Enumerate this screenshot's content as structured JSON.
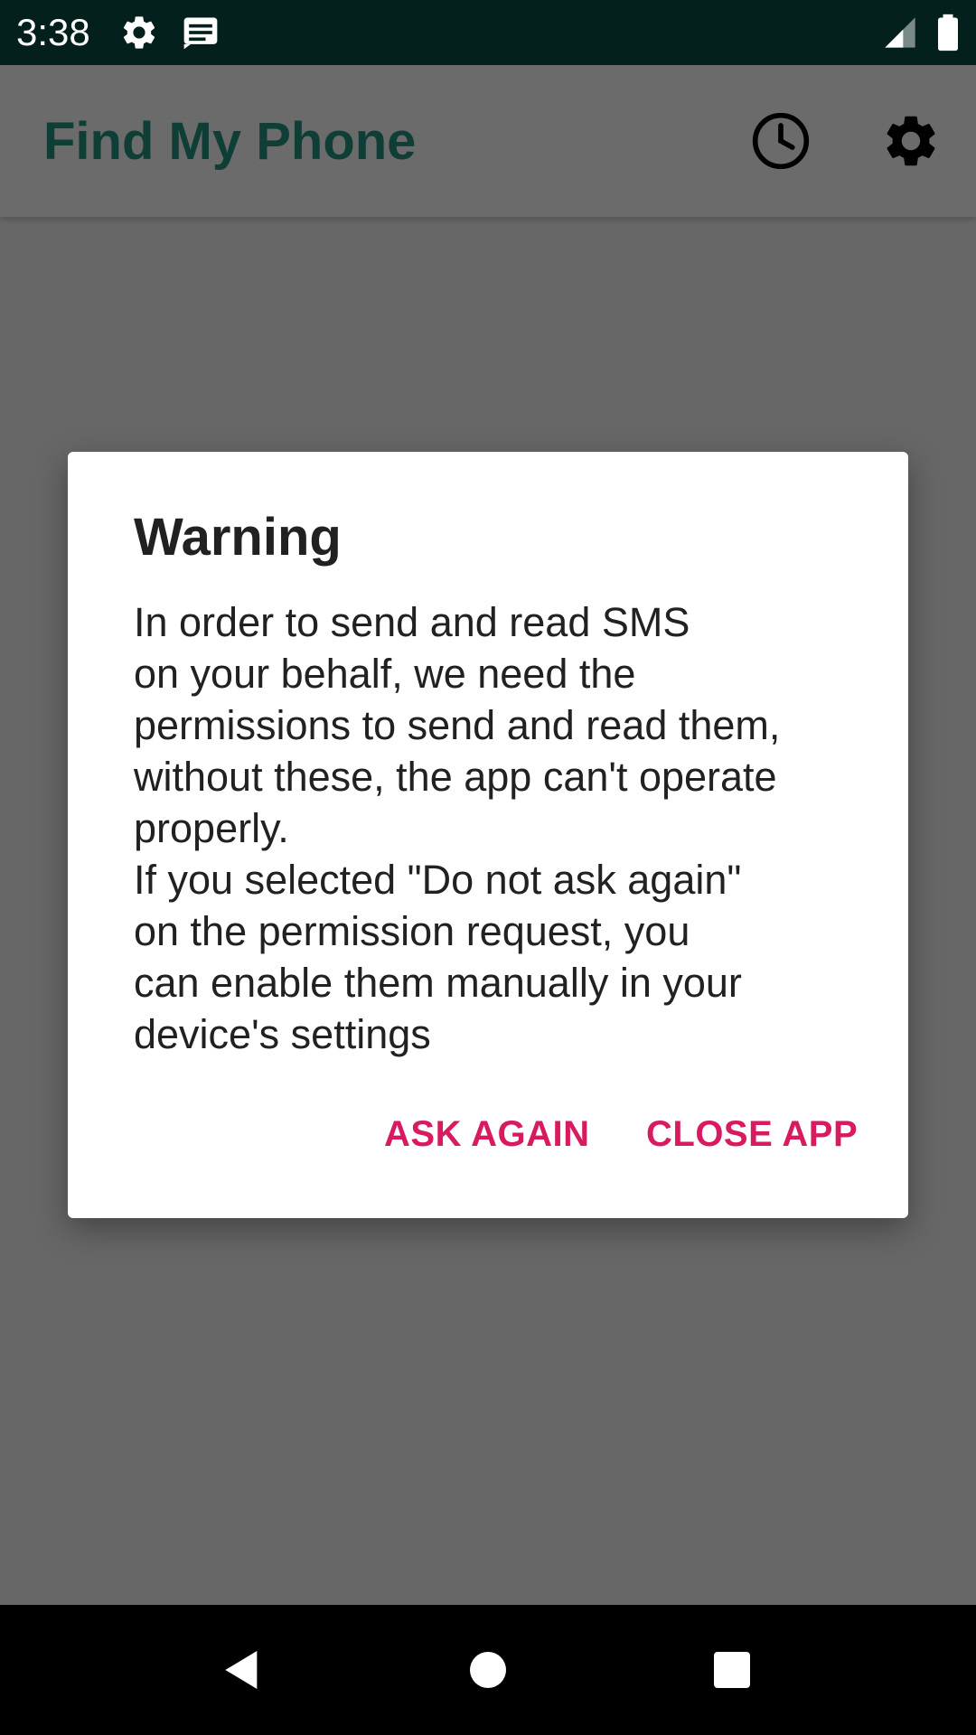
{
  "status_bar": {
    "time": "3:38",
    "icons": [
      "settings-icon",
      "message-icon",
      "signal-icon",
      "battery-icon"
    ]
  },
  "app_bar": {
    "title": "Find My Phone",
    "actions": [
      "history-icon",
      "settings-icon"
    ],
    "title_color": "#0f3e37"
  },
  "dialog": {
    "title": "Warning",
    "message": "In order to send and read SMS\non your behalf, we need the\npermissions to send and read them,\nwithout these, the app can't operate\nproperly.\nIf you selected \"Do not ask again\"\non the permission request, you\ncan enable them manually in your\ndevice's settings",
    "buttons": {
      "ask_again": "ASK AGAIN",
      "close_app": "CLOSE APP"
    },
    "accent_color": "#d81b60"
  },
  "nav_bar": {
    "buttons": [
      "back-icon",
      "home-icon",
      "recents-icon"
    ]
  }
}
